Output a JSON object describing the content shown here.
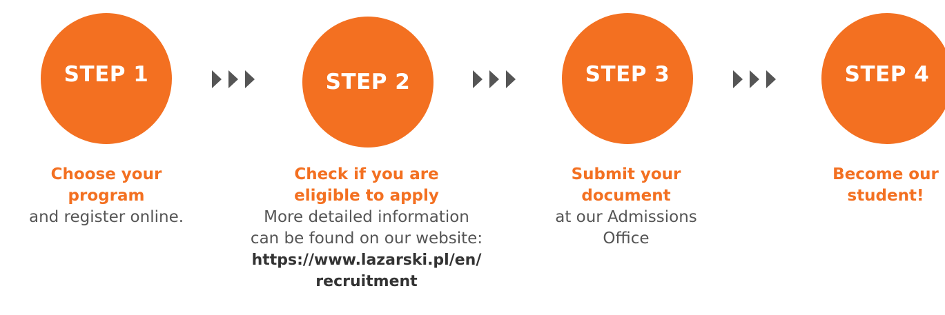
{
  "accent_color": "#f37021",
  "text_color": "#555555",
  "arrow_icon": "triple-chevron-right-icon",
  "steps": [
    {
      "label": "STEP 1",
      "title": "Choose your\nprogram",
      "description": "and register online."
    },
    {
      "label": "STEP 2",
      "title": "Check if you are\neligible to apply",
      "description": "More detailed information\ncan be found on our website:",
      "link": "https://www.lazarski.pl/en/\nrecruitment"
    },
    {
      "label": "STEP 3",
      "title": "Submit your\ndocument",
      "description": "at our Admissions\nOffice"
    },
    {
      "label": "STEP 4",
      "title": "Become our\nstudent!"
    }
  ]
}
